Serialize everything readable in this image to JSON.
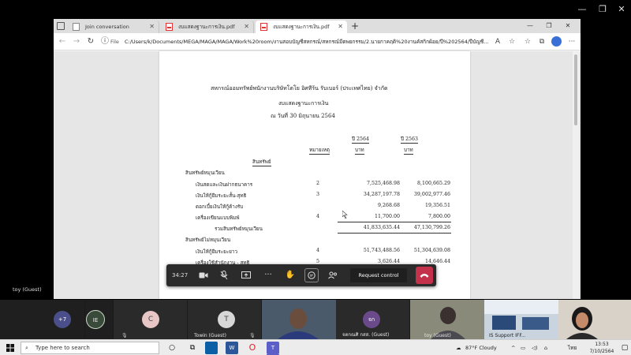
{
  "window": {
    "minimize": "—",
    "maximize": "❐",
    "close": "✕"
  },
  "browser": {
    "tabs": [
      {
        "label": "Join conversation",
        "active": false
      },
      {
        "label": "งบแสดงฐานะการเงิน.pdf",
        "active": false
      },
      {
        "label": "งบแสดงฐานะการเงิน.pdf",
        "active": true
      }
    ],
    "new_tab": "+",
    "url_prefix": "File",
    "url": "C:/Users/k/Documents/MEGA/MAGA/MAGA/Work%20room/งานสอบบัญชีสหกรณ์/สหกรณ์มีตพยกรรม/2.นายกาคฤดิ%20งานคัสกิกผ้อย/ปี%202564/ปีบัญชี..."
  },
  "document": {
    "title": "สหกรณ์ออมทรัพย์พนักงานบริษัทโตโย อิศทีร้น รับเบอร์ (ประเทศไทย) จำกัด",
    "subtitle": "งบแสดงฐานะการเงิน",
    "date_line": "ณ  วันที่  30 มิถุนายน  2564",
    "col_note": "หมายเหตุ",
    "col_year1": "ปี 2564",
    "col_year2": "ปี 2563",
    "col_unit1": "บาท",
    "col_unit2": "บาท",
    "section_assets": "สินทรัพย์",
    "current_assets": "สินทรัพย์หมุนเวียน",
    "rows": [
      {
        "label": "เงินสดและเงินฝากธนาคาร",
        "note": "2",
        "v1": "7,525,468.98",
        "v2": "8,100,665.29"
      },
      {
        "label": "เงินให้กู้ยืมระยะสั้น-สุทธิ",
        "note": "3",
        "v1": "34,287,197.78",
        "v2": "39,002,977.46"
      },
      {
        "label": "ดอกเบี้ยเงินให้กู้ค้างรับ",
        "note": "",
        "v1": "9,268.68",
        "v2": "19,356.51"
      },
      {
        "label": "เครื่องเขียนแบบพิมพ์",
        "note": "4",
        "v1": "11,700.00",
        "v2": "7,800.00"
      }
    ],
    "total_current_label": "รวมสินทรัพย์หมุนเวียน",
    "total_current_v1": "41,833,635.44",
    "total_current_v2": "47,130,799.26",
    "noncurrent_assets": "สินทรัพย์ไม่หมุนเวียน",
    "rows2": [
      {
        "label": "เงินให้กู้ยืมระยะยาว",
        "note": "4",
        "v1": "51,743,488.56",
        "v2": "51,304,639.08"
      },
      {
        "label": "เครื่องใช้สำนักงาน - สุทธิ",
        "note": "5",
        "v1": "3,626.44",
        "v2": "14,646.44"
      }
    ]
  },
  "call": {
    "timer": "34:27",
    "request_control": "Request control",
    "presenter_name": "toy (Guest)"
  },
  "participants": [
    {
      "initials": "+7",
      "name": "",
      "color": "#4a4e8a"
    },
    {
      "initials": "IE",
      "name": "",
      "color": "#3a4a3a"
    },
    {
      "initials": "C",
      "name": "",
      "color": "#e8c6c6"
    },
    {
      "initials": "T",
      "name": "Towin (Guest)",
      "color": "#d7d7d7"
    },
    {
      "initials": "",
      "name": "",
      "color": "#4a5a6a"
    },
    {
      "initials": "จก",
      "name": "จตกณศิ กสส. (Guest)",
      "color": "#6a4a8a"
    },
    {
      "initials": "",
      "name": "toy (Guest)",
      "color": "#7a7a70"
    },
    {
      "initials": "",
      "name": "IS Support IFF...",
      "color": "#5a6a7a"
    },
    {
      "initials": "",
      "name": "",
      "color": "#8a7a6a"
    }
  ],
  "taskbar": {
    "search_placeholder": "Type here to search",
    "weather": "87°F  Cloudy",
    "lang": "ไทย",
    "time": "13:53",
    "date": "7/10/2564"
  }
}
